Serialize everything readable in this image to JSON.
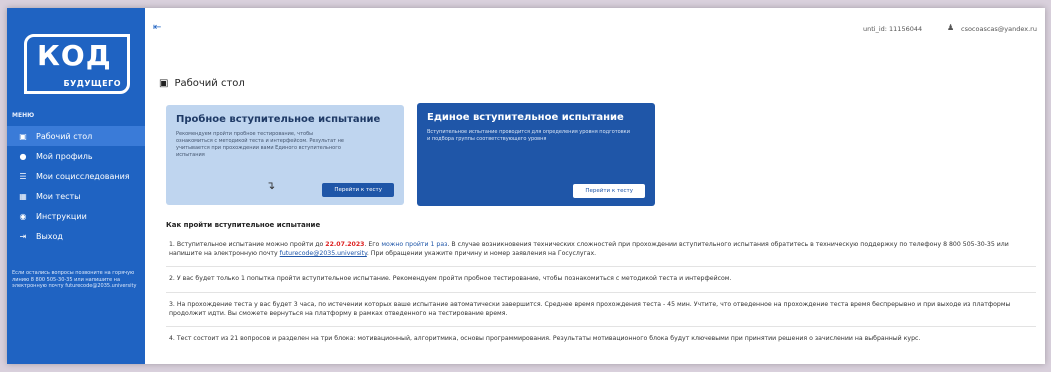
{
  "sidebar": {
    "logo_main": "КОД",
    "logo_sub": "БУДУЩЕГО",
    "menu_title": "МЕНЮ",
    "items": [
      {
        "label": "Рабочий стол",
        "icon": "monitor-icon",
        "active": true
      },
      {
        "label": "Мой профиль",
        "icon": "user-icon",
        "active": false
      },
      {
        "label": "Мои социсследования",
        "icon": "list-icon",
        "active": false
      },
      {
        "label": "Мои тесты",
        "icon": "tests-icon",
        "active": false
      },
      {
        "label": "Инструкции",
        "icon": "info-icon",
        "active": false
      },
      {
        "label": "Выход",
        "icon": "logout-icon",
        "active": false
      }
    ],
    "note": "Если остались вопросы позвоните на горячую линию 8 800 505-30-35 или напишите на электронную почту futurecode@2035.university"
  },
  "topbar": {
    "user_id": "unti_id: 11156044",
    "user_email": "csocoascas@yandex.ru"
  },
  "page": {
    "title": "Рабочий стол"
  },
  "cards": {
    "trial": {
      "title": "Пробное вступительное испытание",
      "text": "Рекомендуем пройти пробное тестирование, чтобы ознакомиться с методикой теста и интерфейсом. Результат не учитывается при прохождении вами Единого вступительного испытания",
      "button": "Перейти к тесту"
    },
    "main": {
      "title": "Единое вступительное испытание",
      "text": "Вступительное испытание проводится для определения уровня подготовки и подбора группы соответствующего уровня",
      "button": "Перейти к тесту"
    }
  },
  "instructions": {
    "heading": "Как пройти вступительное испытание",
    "p1_a": "1. Вступительное испытание можно пройти до ",
    "p1_date": "22.07.2023",
    "p1_b": ". Его ",
    "p1_once": "можно пройти 1 раз",
    "p1_c": ". В случае возникновения технических сложностей при прохождении вступительного испытания обратитесь в техническую поддержку по телефону 8 800 505-30-35 или напишите на электронную почту ",
    "p1_email": "futurecode@2035.university",
    "p1_d": ". При обращении укажите причину и номер заявления на Госуслугах.",
    "p2": "2. У вас будет только 1 попытка пройти вступительное испытание. Рекомендуем пройти пробное тестирование, чтобы познакомиться с методикой теста и интерфейсом.",
    "p3": "3. На прохождение теста у вас будет 3 часа, по истечении которых ваше испытание автоматически завершится. Среднее время прохождения теста - 45 мин. Учтите, что отведенное на прохождение теста время беспрерывно и при выходе из платформы продолжит идти. Вы сможете вернуться на платформу в рамках отведенного на тестирование время.",
    "p4": "4. Тест состоит из 21 вопросов и разделен на три блока: мотивационный, алгоритмика, основы программирования. Результаты мотивационного блока будут ключевыми при принятии решения о зачислении на выбранный курс."
  }
}
